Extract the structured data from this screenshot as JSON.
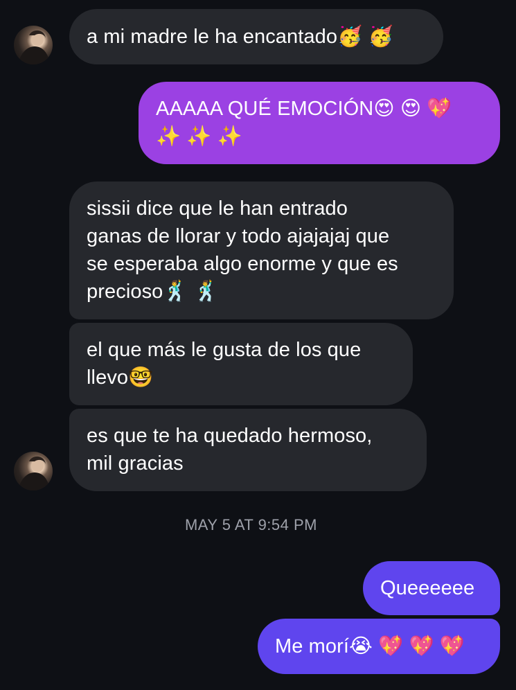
{
  "thread": {
    "messages": [
      {
        "id": "m1",
        "direction": "received",
        "text": "a mi madre le ha encantado🥳 🥳"
      },
      {
        "id": "m2",
        "direction": "sent",
        "text": "AAAAA QUÉ EMOCIÓN😍 😍 💖\n✨ ✨ ✨"
      },
      {
        "id": "m3",
        "direction": "received",
        "text": "sissii dice que le han entrado\nganas de llorar y todo ajajajaj que\nse esperaba algo enorme y que es\nprecioso🕺 🕺"
      },
      {
        "id": "m4",
        "direction": "received",
        "text": "el que más le gusta de los que\nllevo🤓"
      },
      {
        "id": "m5",
        "direction": "received",
        "text": "es que te ha quedado hermoso,\nmil gracias"
      },
      {
        "id": "m6",
        "direction": "sent",
        "text": "Queeeeee"
      },
      {
        "id": "m7",
        "direction": "sent",
        "text": "Me morí😭 💖 💖 💖"
      }
    ],
    "timestamp": "MAY 5 AT 9:54 PM"
  },
  "colors": {
    "background": "#0e1015",
    "received_bubble": "#26282d",
    "sent_bubble_purple": "#9b41e3",
    "sent_bubble_indigo": "#5f45ee",
    "timestamp_text": "#9ea1aa"
  },
  "avatar_icon": "contact-avatar"
}
